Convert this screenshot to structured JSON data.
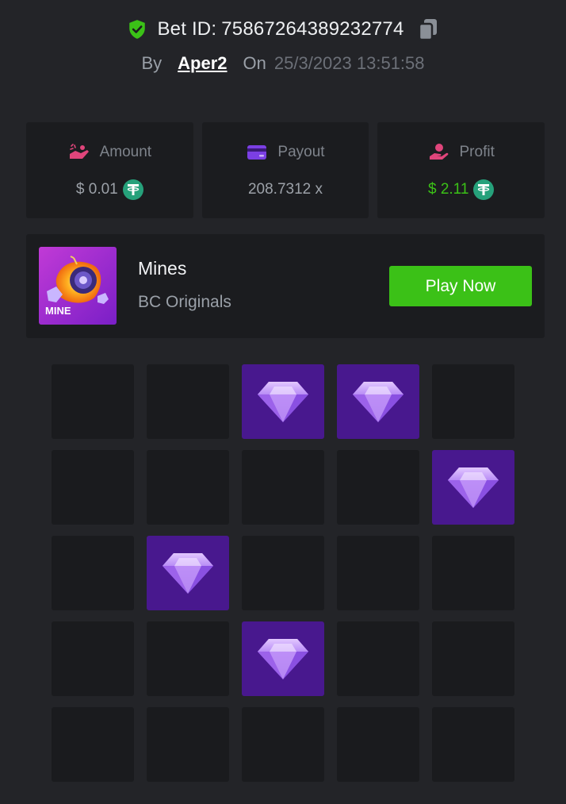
{
  "header": {
    "bet_label": "Bet ID:",
    "bet_id": "75867264389232774",
    "by_label": "By",
    "username": "Aper2",
    "on_label": "On",
    "datetime": "25/3/2023 13:51:58"
  },
  "stats": {
    "amount": {
      "label": "Amount",
      "value": "$ 0.01",
      "coin": "tether-coin-icon"
    },
    "payout": {
      "label": "Payout",
      "value": "208.7312 x"
    },
    "profit": {
      "label": "Profit",
      "value": "$ 2.11",
      "coin": "tether-coin-icon"
    }
  },
  "game": {
    "title": "Mines",
    "subtitle": "BC Originals",
    "thumb_text": "MINE",
    "play_label": "Play Now"
  },
  "grid": {
    "rows": 5,
    "cols": 5,
    "tiles": [
      [
        0,
        0,
        1,
        1,
        0
      ],
      [
        0,
        0,
        0,
        0,
        1
      ],
      [
        0,
        1,
        0,
        0,
        0
      ],
      [
        0,
        0,
        1,
        0,
        0
      ],
      [
        0,
        0,
        0,
        0,
        0
      ]
    ]
  },
  "colors": {
    "background": "#232428",
    "card": "#1b1c1f",
    "tile": "#1a1b1e",
    "gem_tile": "#48188e",
    "accent_green": "#3bc117",
    "payout_icon": "#7b3fe4",
    "amount_icon": "#e0457b",
    "profit_icon": "#e0457b",
    "shield": "#3bc117",
    "tether": "#26a17b"
  }
}
